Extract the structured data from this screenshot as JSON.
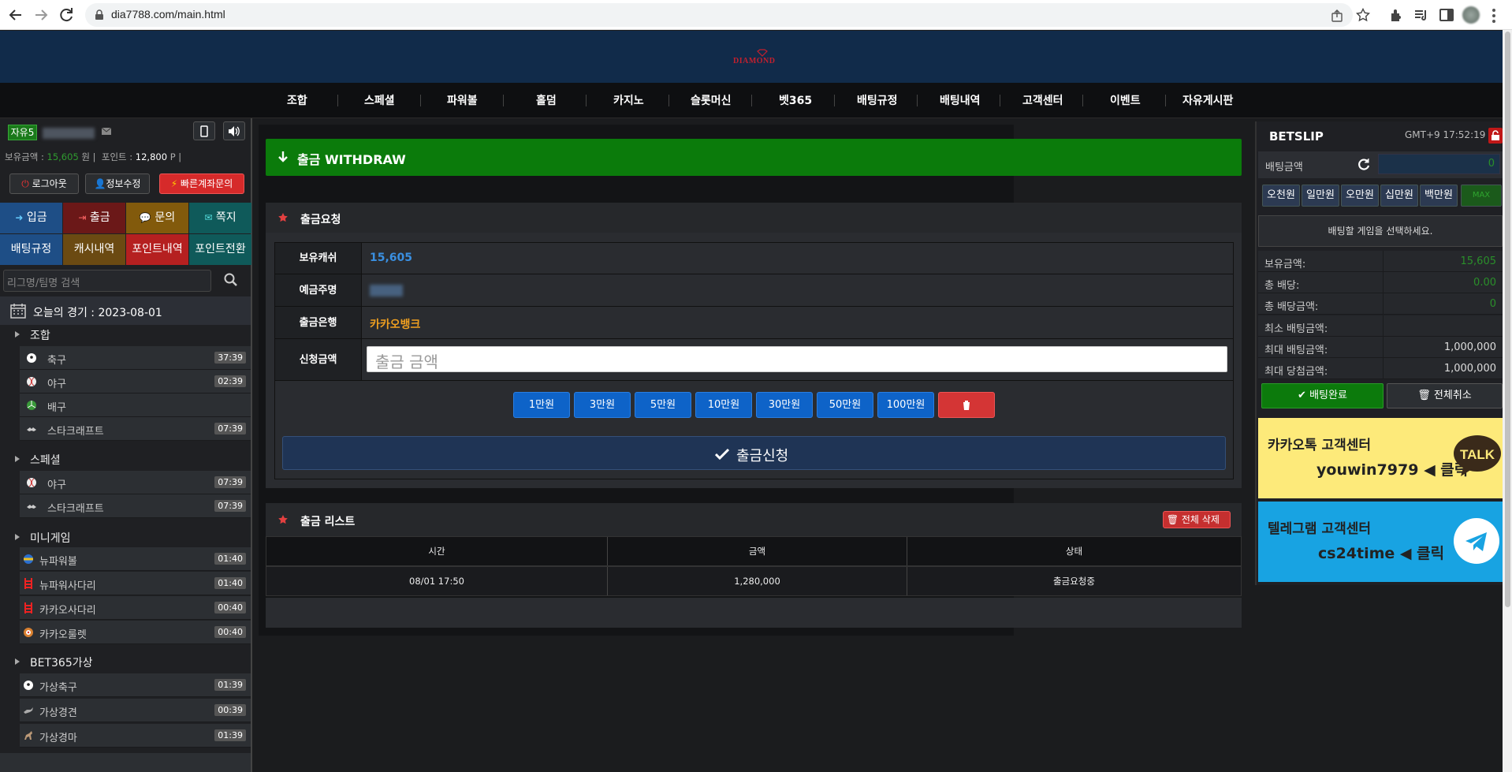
{
  "browser": {
    "url": "dia7788.com/main.html"
  },
  "logo": {
    "text": "DIAMOND"
  },
  "nav": [
    "조합",
    "스페셜",
    "파워볼",
    "홀덤",
    "카지노",
    "슬롯머신",
    "벳365",
    "배팅규정",
    "배팅내역",
    "고객센터",
    "이벤트",
    "자유게시판"
  ],
  "user": {
    "level": "자유5",
    "balance_label": "보유금액 :",
    "balance": "15,605",
    "balance_unit": "원",
    "point_label": "포인트 :",
    "point": "12,800",
    "point_unit": "P",
    "logout": "로그아웃",
    "edit": "정보수정",
    "fast_account": "빠른계좌문의"
  },
  "quick": {
    "deposit": "입금",
    "withdraw": "출금",
    "inquiry": "문의",
    "message": "쪽지",
    "rules": "배팅규정",
    "cash_history": "캐시내역",
    "point_history": "포인트내역",
    "point_convert": "포인트전환"
  },
  "search": {
    "placeholder": "리그명/팀명 검색"
  },
  "today": {
    "label": "오늘의 경기 : 2023-08-01"
  },
  "sports": {
    "combo": {
      "label": "조합",
      "items": [
        {
          "name": "축구",
          "time": "37:39"
        },
        {
          "name": "야구",
          "time": "02:39"
        },
        {
          "name": "배구",
          "time": ""
        },
        {
          "name": "스타크래프트",
          "time": "07:39"
        }
      ]
    },
    "special": {
      "label": "스페셜",
      "items": [
        {
          "name": "야구",
          "time": "07:39"
        },
        {
          "name": "스타크래프트",
          "time": "07:39"
        }
      ]
    },
    "minigame": {
      "label": "미니게임",
      "items": [
        {
          "name": "뉴파워볼",
          "time": "01:40"
        },
        {
          "name": "뉴파워사다리",
          "time": "01:40"
        },
        {
          "name": "카카오사다리",
          "time": "00:40"
        },
        {
          "name": "카카오룰렛",
          "time": "00:40"
        }
      ]
    },
    "bet365": {
      "label": "BET365가상",
      "items": [
        {
          "name": "가상축구",
          "time": "01:39"
        },
        {
          "name": "가상경견",
          "time": "00:39"
        },
        {
          "name": "가상경마",
          "time": "01:39"
        }
      ]
    }
  },
  "withdraw": {
    "title": "출금 WITHDRAW",
    "request_title": "출금요청",
    "cash_label": "보유캐쉬",
    "cash_value": "15,605",
    "holder_label": "예금주명",
    "bank_label": "출금은행",
    "bank_value": "카카오뱅크",
    "amount_label": "신청금액",
    "amount_placeholder": "출금 금액",
    "amount_buttons": [
      "1만원",
      "3만원",
      "5만원",
      "10만원",
      "30만원",
      "50만원",
      "100만원"
    ],
    "submit": "출금신청"
  },
  "withdraw_list": {
    "title": "출금 리스트",
    "delete_all": "전체 삭제",
    "columns": [
      "시간",
      "금액",
      "상태"
    ],
    "rows": [
      {
        "time": "08/01 17:50",
        "amount": "1,280,000",
        "status": "출금요청중"
      }
    ]
  },
  "betslip": {
    "title": "BETSLIP",
    "clock": "GMT+9 17:52:19",
    "amount_label": "배팅금액",
    "amount_value": "0",
    "chips": [
      "오천원",
      "일만원",
      "오만원",
      "십만원",
      "백만원",
      "MAX"
    ],
    "notice": "배팅할 게임을 선택하세요.",
    "stats": [
      {
        "key": "보유금액:",
        "value": "15,605",
        "color": "#2a8f2a"
      },
      {
        "key": "총 배당:",
        "value": "0.00",
        "color": "#2a8f2a"
      },
      {
        "key": "총 배당금액:",
        "value": "0",
        "color": "#2a8f2a"
      },
      {
        "key": "최소 배팅금액:",
        "value": "",
        "color": "#ddd"
      },
      {
        "key": "최대 배팅금액:",
        "value": "1,000,000",
        "color": "#ddd"
      },
      {
        "key": "최대 당첨금액:",
        "value": "1,000,000",
        "color": "#ddd"
      }
    ],
    "confirm": "배팅완료",
    "cancel_all": "전체취소"
  },
  "kakao": {
    "title": "카카오톡 고객센터",
    "id": "youwin7979",
    "click": "◀ 클릭",
    "talk": "TALK"
  },
  "telegram": {
    "title": "텔레그램 고객센터",
    "id": "cs24time",
    "click": "◀ 클릭"
  },
  "colors": {
    "header": "#112b4a",
    "withdraw_green": "#0b7b0b",
    "amount_blue": "#0e63c8",
    "kakao_yellow": "#fdea7a",
    "telegram_blue": "#18a3e2",
    "accent_orange": "#f0a020"
  }
}
